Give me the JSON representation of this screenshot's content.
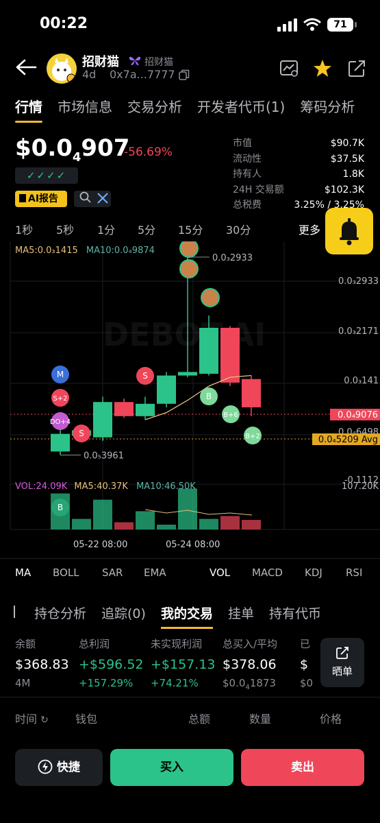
{
  "status": {
    "time": "00:22",
    "battery": "71"
  },
  "header": {
    "name": "招财猫",
    "subname": "招财猫",
    "age": "4d",
    "address": "0x7a...7777"
  },
  "tabs": [
    "行情",
    "市场信息",
    "交易分析",
    "开发者代币(1)",
    "筹码分析"
  ],
  "price": {
    "main": "$0.0",
    "sub": "4",
    "rest": "907",
    "change": "-56.69%",
    "checks": "✓✓✓✓",
    "ai_label": "AI报告"
  },
  "stats": [
    {
      "label": "市值",
      "value": "$90.7K"
    },
    {
      "label": "流动性",
      "value": "$37.5K"
    },
    {
      "label": "持有人",
      "value": "1.8K"
    },
    {
      "label": "24H 交易额",
      "value": "$102.3K"
    },
    {
      "label": "总税费",
      "value": "3.25% / 3.25%"
    }
  ],
  "timeframes": [
    "1秒",
    "5秒",
    "1分",
    "5分",
    "15分",
    "30分"
  ],
  "more_label": "更多",
  "chart_data": {
    "type": "candlestick",
    "watermark": "DEBOT.AI",
    "ma_legend": {
      "ma5": "MA5:0.0₃1415",
      "ma10": "MA10:0.0₄9874"
    },
    "price_axis": [
      "0.0₃2933",
      "0.0₃2171",
      "0.0₃141",
      "0.0₄6498",
      "-0.1112"
    ],
    "current_price_tag": "0.0₄9076",
    "avg_price_tag": "0.0₄5209 Avg",
    "high_label": "0.0₃2933",
    "low_label": "0.0₅3961",
    "candles": [
      {
        "open": 0.35,
        "close": 0.45,
        "high": 0.52,
        "low": 0.33,
        "dir": "up"
      },
      {
        "open": 0.44,
        "close": 0.47,
        "high": 0.49,
        "low": 0.43,
        "dir": "up"
      },
      {
        "open": 0.43,
        "close": 0.63,
        "high": 0.66,
        "low": 0.41,
        "dir": "up"
      },
      {
        "open": 0.63,
        "close": 0.55,
        "high": 0.65,
        "low": 0.54,
        "dir": "down"
      },
      {
        "open": 0.55,
        "close": 0.62,
        "high": 0.66,
        "low": 0.53,
        "dir": "up"
      },
      {
        "open": 0.62,
        "close": 0.78,
        "high": 0.8,
        "low": 0.6,
        "dir": "up"
      },
      {
        "open": 0.78,
        "close": 0.8,
        "high": 1.45,
        "low": 0.77,
        "dir": "up"
      },
      {
        "open": 0.79,
        "close": 1.05,
        "high": 1.12,
        "low": 0.78,
        "dir": "up"
      },
      {
        "open": 1.05,
        "close": 0.74,
        "high": 1.06,
        "low": 0.72,
        "dir": "down"
      },
      {
        "open": 0.76,
        "close": 0.6,
        "high": 0.78,
        "low": 0.55,
        "dir": "down"
      }
    ],
    "ma5_points": [
      0.53,
      0.57,
      0.64,
      0.72,
      0.77,
      0.78
    ],
    "volume": {
      "legend_vol": "VOL:24.09K",
      "ma5": "MA5:40.37K",
      "ma10": "MA10:46.50K",
      "axis_max": "107.20K",
      "bars": [
        0.75,
        0.22,
        0.62,
        0.15,
        0.38,
        0.1,
        0.85,
        0.22,
        0.28,
        0.2
      ],
      "dirs": [
        "up",
        "up",
        "up",
        "down",
        "up",
        "up",
        "up",
        "up",
        "down",
        "down"
      ]
    },
    "markers": [
      "M",
      "S+2",
      "DO+4",
      "S",
      "S",
      "B",
      "B+6",
      "B+2",
      "B"
    ],
    "dates": [
      "05-22 08:00",
      "05-24 08:00"
    ]
  },
  "indicators": [
    "MA",
    "BOLL",
    "SAR",
    "EMA",
    "VOL",
    "MACD",
    "KDJ",
    "RSI"
  ],
  "trade_tabs": [
    "持仓分析",
    "追踪(0)",
    "我的交易",
    "挂单",
    "持有代币"
  ],
  "summary": {
    "balance_label": "余额",
    "balance": "$368.83",
    "balance_sub": "4M",
    "profit_label": "总利润",
    "profit": "+$596.52",
    "profit_pct": "+157.29%",
    "unreal_label": "未实现利润",
    "unreal": "+$157.13",
    "unreal_pct": "+74.21%",
    "buy_label": "总买入/平均",
    "buy": "$378.06",
    "buy_avg": "$0.0",
    "buy_avg_sub": "4",
    "buy_avg_rest": "1873",
    "cut_label": "已",
    "cut_val": "$",
    "cut_sub": "$0",
    "share": "晒单"
  },
  "table_headers": [
    "时间",
    "钱包",
    "总额",
    "数量",
    "价格"
  ],
  "actions": {
    "quick": "快捷",
    "buy": "买入",
    "sell": "卖出"
  }
}
